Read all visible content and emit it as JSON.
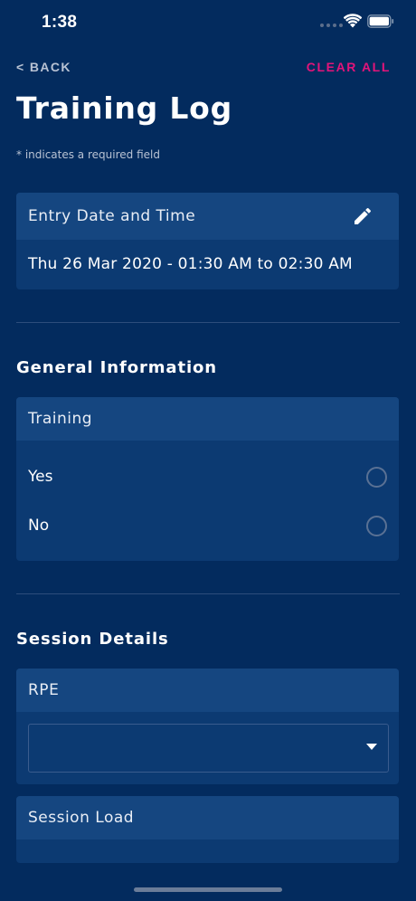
{
  "status_bar": {
    "time": "1:38"
  },
  "nav": {
    "back_label": "< BACK",
    "clear_label": "CLEAR ALL"
  },
  "page": {
    "title": "Training Log",
    "required_note": "* indicates a required field"
  },
  "entry_date": {
    "label": "Entry Date and Time",
    "value": "Thu 26 Mar 2020 - 01:30 AM to 02:30 AM"
  },
  "general_information": {
    "title": "General Information",
    "training": {
      "label": "Training",
      "options": [
        "Yes",
        "No"
      ]
    }
  },
  "session_details": {
    "title": "Session Details",
    "rpe": {
      "label": "RPE",
      "value": ""
    },
    "session_load": {
      "label": "Session Load"
    }
  },
  "colors": {
    "background": "#032B5E",
    "card": "#0C3A72",
    "card_header": "#154680",
    "accent": "#E3147A",
    "muted_text": "#B8C2D3"
  },
  "icons": {
    "edit": "pencil-icon",
    "dropdown": "caret-down-icon"
  }
}
